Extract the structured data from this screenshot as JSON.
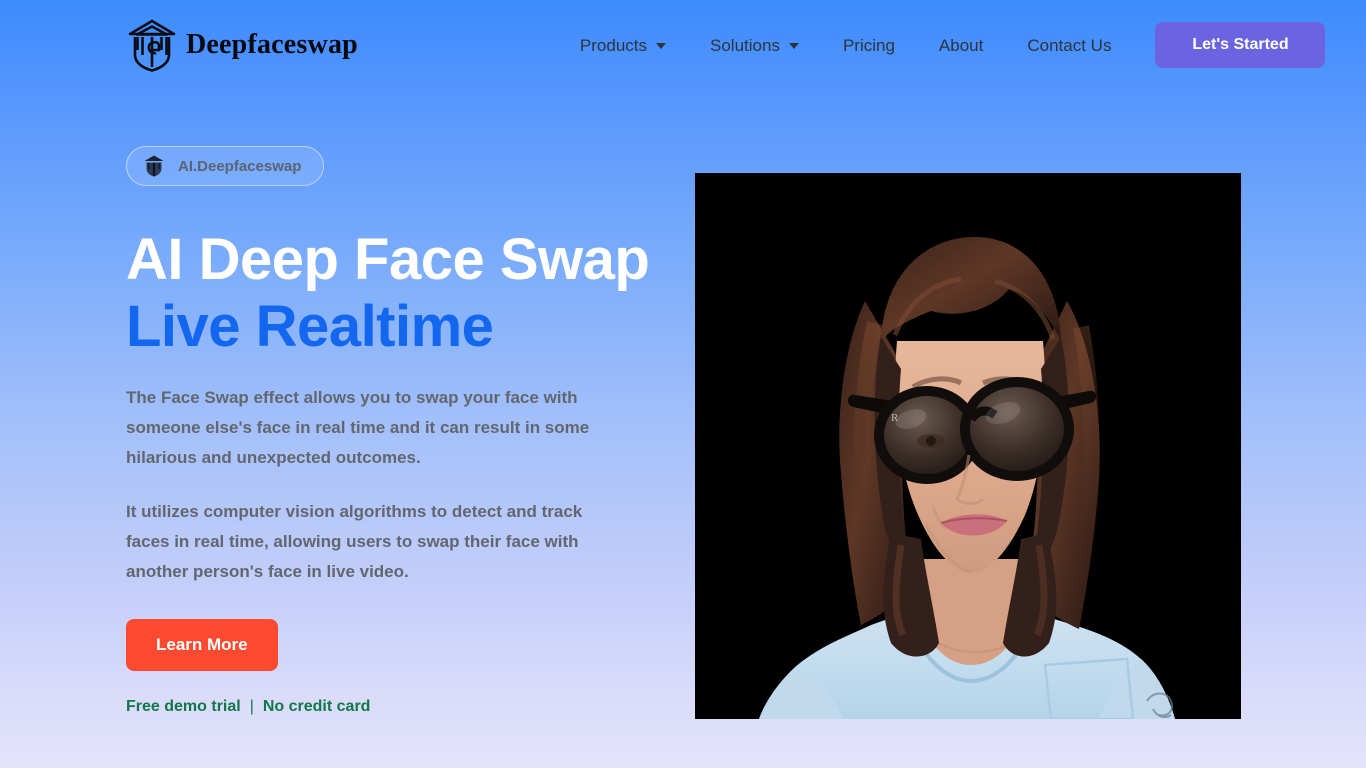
{
  "header": {
    "brand": {
      "name": "Deepfaceswap",
      "icon": "deepfaceswap-logo-icon"
    },
    "nav": [
      {
        "label": "Products",
        "has_caret": true
      },
      {
        "label": "Solutions",
        "has_caret": true
      },
      {
        "label": "Pricing",
        "has_caret": false
      },
      {
        "label": "About",
        "has_caret": false
      },
      {
        "label": "Contact Us",
        "has_caret": false
      }
    ],
    "cta": {
      "label": "Let's Started",
      "color": "#6c63e0"
    }
  },
  "hero": {
    "badge": {
      "label": "AI.Deepfaceswap",
      "icon": "deepfaceswap-shield-icon"
    },
    "headline": {
      "line1": "AI Deep Face Swap",
      "line2": "Live Realtime",
      "line1_color": "#ffffff",
      "line2_color": "#1267ee"
    },
    "paragraphs": [
      "The Face Swap effect allows you to swap your face with someone else's face in real time and it can result in some hilarious and unexpected outcomes.",
      "It utilizes computer vision algorithms to detect and track faces in real time, allowing users to swap their face with another person's face in live video."
    ],
    "learn_more": {
      "label": "Learn More",
      "color": "#fb4a2f"
    },
    "trial": {
      "left": "Free demo trial",
      "separator": "|",
      "right": "No credit card",
      "color": "#11784a"
    },
    "image": {
      "alt": "Woman with long brown hair wearing large dark oversized sunglasses and a light blue t-shirt on a black background",
      "background": "#000000"
    }
  },
  "theme": {
    "page_gradient_top": "#3d8bfd",
    "page_gradient_bottom": "#e3e3fb",
    "nav_text": "#2b3440",
    "body_text": "#62676f"
  }
}
